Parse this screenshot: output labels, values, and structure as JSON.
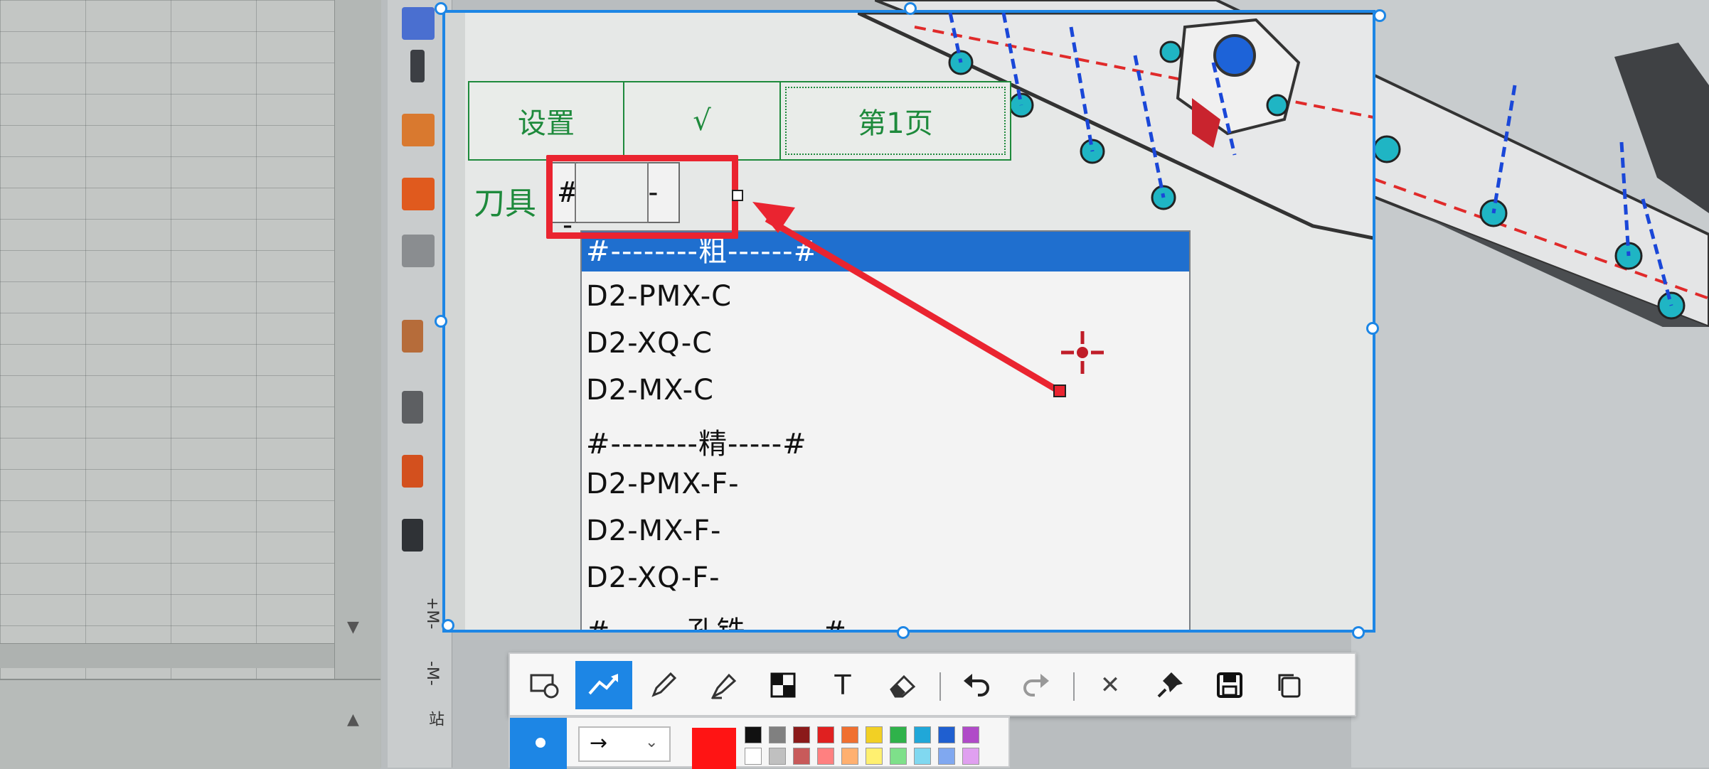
{
  "capture_window": {
    "buttons": {
      "settings": "设置",
      "confirm": "√",
      "page": "第1页"
    },
    "tool_label": "刀具",
    "tool_combo_value": "#------",
    "tool_options": [
      "#--------粗------#",
      "D2-PMX-C",
      "D2-XQ-C",
      "D2-MX-C",
      "#--------精-----#",
      "D2-PMX-F-",
      "D2-MX-F-",
      "D2-XQ-F-",
      "#-------孔铣-------#"
    ],
    "selected_option_index": 0
  },
  "cad_side_labels": [
    "+M-",
    "-M-",
    "站"
  ],
  "snip_toolbar": {
    "tools": [
      {
        "name": "shape",
        "icon": "rect-shape-icon"
      },
      {
        "name": "arrow",
        "icon": "arrow-line-icon",
        "active": true
      },
      {
        "name": "pencil",
        "icon": "pencil-icon"
      },
      {
        "name": "highlighter",
        "icon": "highlighter-icon"
      },
      {
        "name": "mosaic",
        "icon": "mosaic-icon"
      },
      {
        "name": "text",
        "icon": "text-icon",
        "glyph": "T"
      },
      {
        "name": "eraser",
        "icon": "eraser-icon"
      },
      {
        "name": "undo",
        "icon": "undo-icon"
      },
      {
        "name": "redo",
        "icon": "redo-icon"
      },
      {
        "name": "cancel",
        "icon": "close-icon",
        "glyph": "✕"
      },
      {
        "name": "pin",
        "icon": "pin-icon"
      },
      {
        "name": "save",
        "icon": "save-icon"
      },
      {
        "name": "copy",
        "icon": "copy-icon"
      }
    ],
    "line_style_glyph": "→",
    "current_color": "#ff1414",
    "palette": [
      "#111111",
      "#808080",
      "#8b1a1a",
      "#e02020",
      "#f07030",
      "#f2d024",
      "#2fb24a",
      "#20a7d8",
      "#1f5fd0",
      "#b04ac8",
      "#ffffff",
      "#c0c0c0",
      "#c85a5a",
      "#ff8080",
      "#ffb070",
      "#fff070",
      "#7ee08a",
      "#80d8f0",
      "#80a8f0",
      "#e0a0f0"
    ]
  },
  "colors": {
    "window_border": "#1d86e5",
    "form_green": "#1e8a3c",
    "annotation_red": "#ea2430",
    "selection_blue": "#1f6fcf"
  }
}
